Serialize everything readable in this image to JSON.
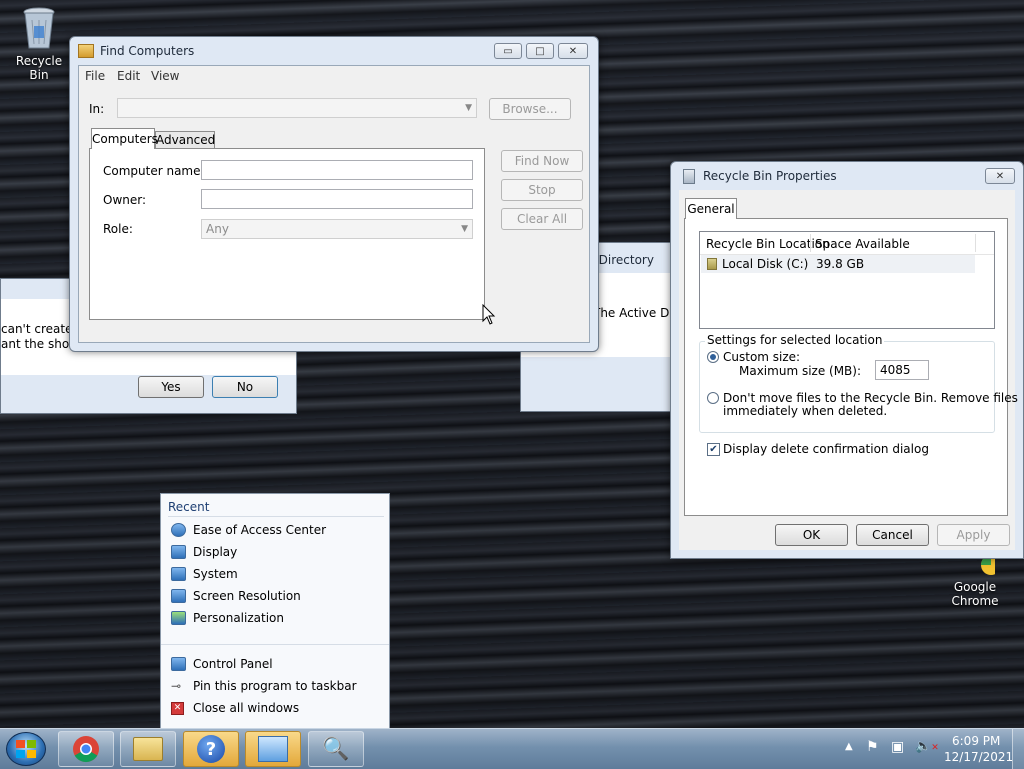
{
  "desktop": {
    "recycle_bin_label": "Recycle Bin",
    "chrome_label_1": "Google",
    "chrome_label_2": "Chrome"
  },
  "find_computers": {
    "title": "Find Computers",
    "menu": [
      "File",
      "Edit",
      "View"
    ],
    "in_label": "In:",
    "browse_label": "Browse...",
    "tabs": [
      "Computers",
      "Advanced"
    ],
    "computer_name_label": "Computer name:",
    "owner_label": "Owner:",
    "role_label": "Role:",
    "role_value": "Any",
    "find_now_label": "Find Now",
    "stop_label": "Stop",
    "clear_all_label": "Clear All"
  },
  "behind_dialog": {
    "text_line1": "can't create a",
    "text_line2": "ant the shortc",
    "yes_label": "Yes",
    "no_label": "No"
  },
  "find_dir": {
    "title": "Find in the Directory",
    "message": "The Active Dire"
  },
  "recycle_props": {
    "title": "Recycle Bin Properties",
    "tab": "General",
    "col_location": "Recycle Bin Location",
    "col_space": "Space Available",
    "row_location": "Local Disk (C:)",
    "row_space": "39.8 GB",
    "group_label": "Settings for selected location",
    "custom_size_label": "Custom size:",
    "max_size_label": "Maximum size (MB):",
    "max_size_value": "4085",
    "dont_move_line1": "Don't move files to the Recycle Bin. Remove files",
    "dont_move_line2": "immediately when deleted.",
    "display_confirm_label": "Display delete confirmation dialog",
    "ok_label": "OK",
    "cancel_label": "Cancel",
    "apply_label": "Apply"
  },
  "jump_list": {
    "recent_header": "Recent",
    "recent": [
      "Ease of Access Center",
      "Display",
      "System",
      "Screen Resolution",
      "Personalization"
    ],
    "tasks": [
      "Control Panel",
      "Pin this program to taskbar",
      "Close all windows"
    ]
  },
  "taskbar": {
    "time": "6:09 PM",
    "date": "12/17/2021"
  }
}
